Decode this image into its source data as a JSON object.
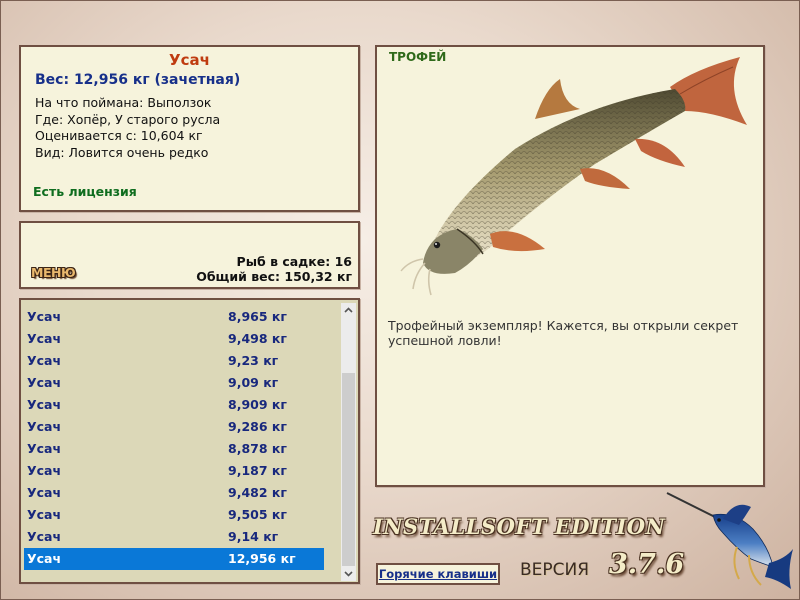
{
  "info": {
    "fish_name": "Усач",
    "weight": "Вес: 12,956 кг (зачетная)",
    "details": [
      "На что поймана: Выползок",
      "Где: Хопёр, У старого русла",
      "Оценивается с: 10,604 кг",
      "Вид: Ловится очень редко"
    ],
    "license": "Есть лицензия"
  },
  "keepnet": {
    "menu_label": "МЕНЮ",
    "fish_count": "Рыб в садке: 16",
    "total_weight": "Общий вес: 150,32 кг"
  },
  "catch_list": [
    {
      "name": "Усач",
      "weight": "8,965 кг"
    },
    {
      "name": "Усач",
      "weight": "9,498 кг"
    },
    {
      "name": "Усач",
      "weight": "9,23 кг"
    },
    {
      "name": "Усач",
      "weight": "9,09 кг"
    },
    {
      "name": "Усач",
      "weight": "8,909 кг"
    },
    {
      "name": "Усач",
      "weight": "9,286 кг"
    },
    {
      "name": "Усач",
      "weight": "8,878 кг"
    },
    {
      "name": "Усач",
      "weight": "9,187 кг"
    },
    {
      "name": "Усач",
      "weight": "9,482 кг"
    },
    {
      "name": "Усач",
      "weight": "9,505 кг"
    },
    {
      "name": "Усач",
      "weight": "9,14 кг"
    },
    {
      "name": "Усач",
      "weight": "12,956 кг",
      "selected": true
    }
  ],
  "trophy": {
    "title": "ТРОФЕЙ",
    "description": "Трофейный экземпляр! Кажется, вы открыли секрет успешной ловли!"
  },
  "branding": {
    "edition": "INSTALLSOFT EDITION",
    "version_label": "ВЕРСИЯ",
    "version_number": "3.7.6"
  },
  "hotkeys_label": "Горячие клавиши",
  "icons": {
    "scroll_up": "chevron-up-icon",
    "scroll_down": "chevron-down-icon",
    "fish_picture": "barbel-fish-icon",
    "logo_picture": "marlin-icon"
  },
  "colors": {
    "panel_background": "#f6f3dc",
    "panel_border": "#6f4f42",
    "fish_name": "#bf3b10",
    "weight_text": "#17308a",
    "license_text": "#0f6d1f",
    "selection": "#0a78d7"
  }
}
